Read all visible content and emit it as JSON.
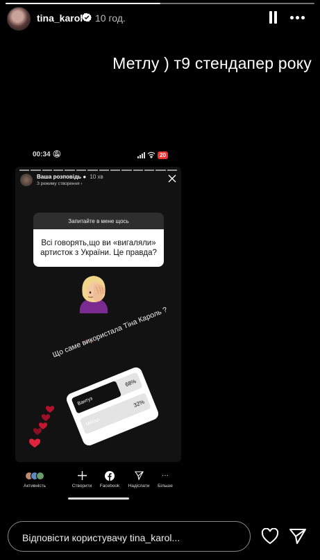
{
  "story": {
    "progress": 0.5,
    "username": "tina_karol",
    "time_ago": "10 год.",
    "caption": "Метлу ) т9 стендапер року"
  },
  "screenshot": {
    "status_time": "00:34",
    "battery": "20",
    "inner_story": {
      "title": "Ваша розповідь",
      "time": "10 хв",
      "subtitle": "З режиму створення",
      "question_header": "Запитайте в мене щось",
      "question_text": "Всі говорять,що ви «вигаляли» артисток з України. Це правда?",
      "quiz_question": "Що саме використала Тіна Кароль ?",
      "poll": [
        {
          "label": "Вантуз",
          "percent": "68%",
          "value": 68
        },
        {
          "label": "Метал",
          "percent": "32%",
          "value": 32
        }
      ]
    },
    "nav": {
      "activity": "Активність",
      "create": "Створити",
      "facebook": "Facebook",
      "send": "Надіслати",
      "more": "Більше"
    }
  },
  "reply": {
    "placeholder": "Відповісти користувачу tina_karol..."
  },
  "colors": {
    "background": "#000000",
    "verified": "#ffffff",
    "battery": "#e33333"
  }
}
